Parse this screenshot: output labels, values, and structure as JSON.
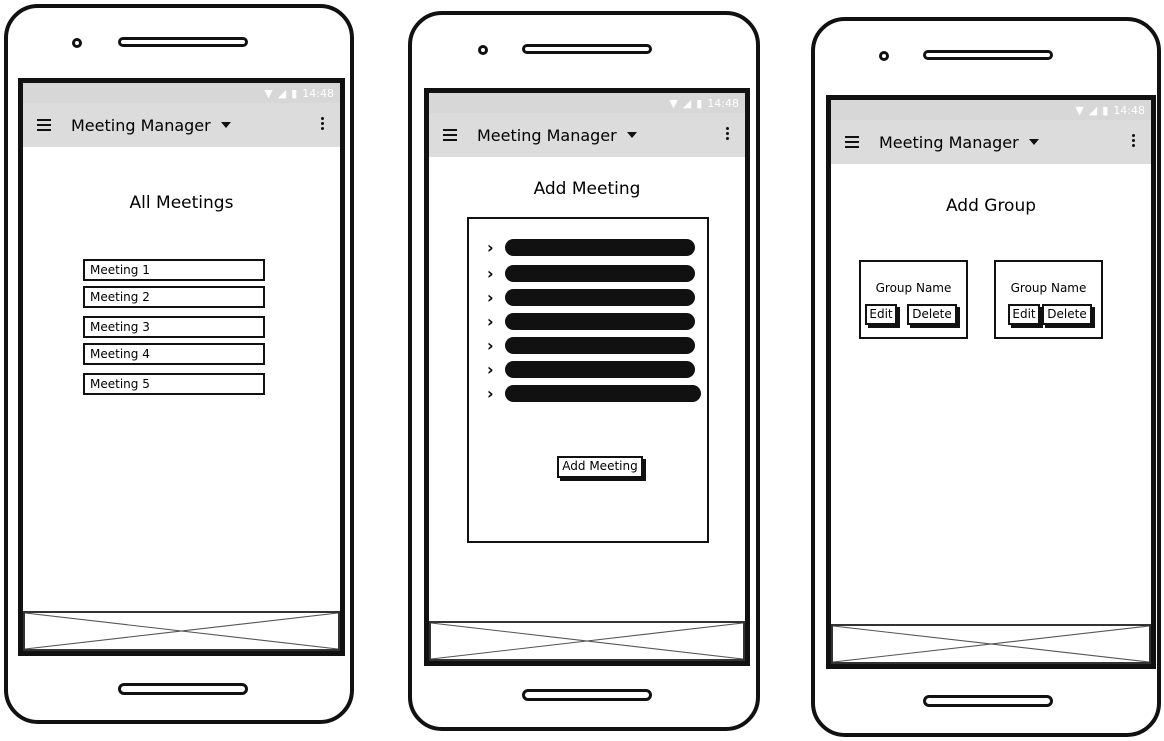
{
  "status_bar": {
    "time": "14:48",
    "wifi_icon": "wifi-icon",
    "signal_icon": "signal-icon",
    "battery_icon": "battery-icon"
  },
  "app_bar": {
    "title": "Meeting Manager",
    "menu_icon": "hamburger-icon",
    "dropdown_icon": "caret-down-icon",
    "overflow_icon": "kebab-icon"
  },
  "screens": {
    "all_meetings": {
      "heading": "All Meetings",
      "meetings": [
        "Meeting 1",
        "Meeting 2",
        "Meeting 3",
        "Meeting 4",
        "Meeting 5"
      ]
    },
    "add_meeting": {
      "heading": "Add Meeting",
      "button_label": "Add Meeting"
    },
    "add_group": {
      "heading": "Add Group",
      "groups": [
        {
          "name": "Group Name",
          "edit_label": "Edit",
          "delete_label": "Delete"
        },
        {
          "name": "Group Name",
          "edit_label": "Edit",
          "delete_label": "Delete"
        }
      ]
    }
  },
  "colors": {
    "bar_background": "#dcdcdc",
    "status_background": "#d7d7d7",
    "outline": "#111111"
  }
}
